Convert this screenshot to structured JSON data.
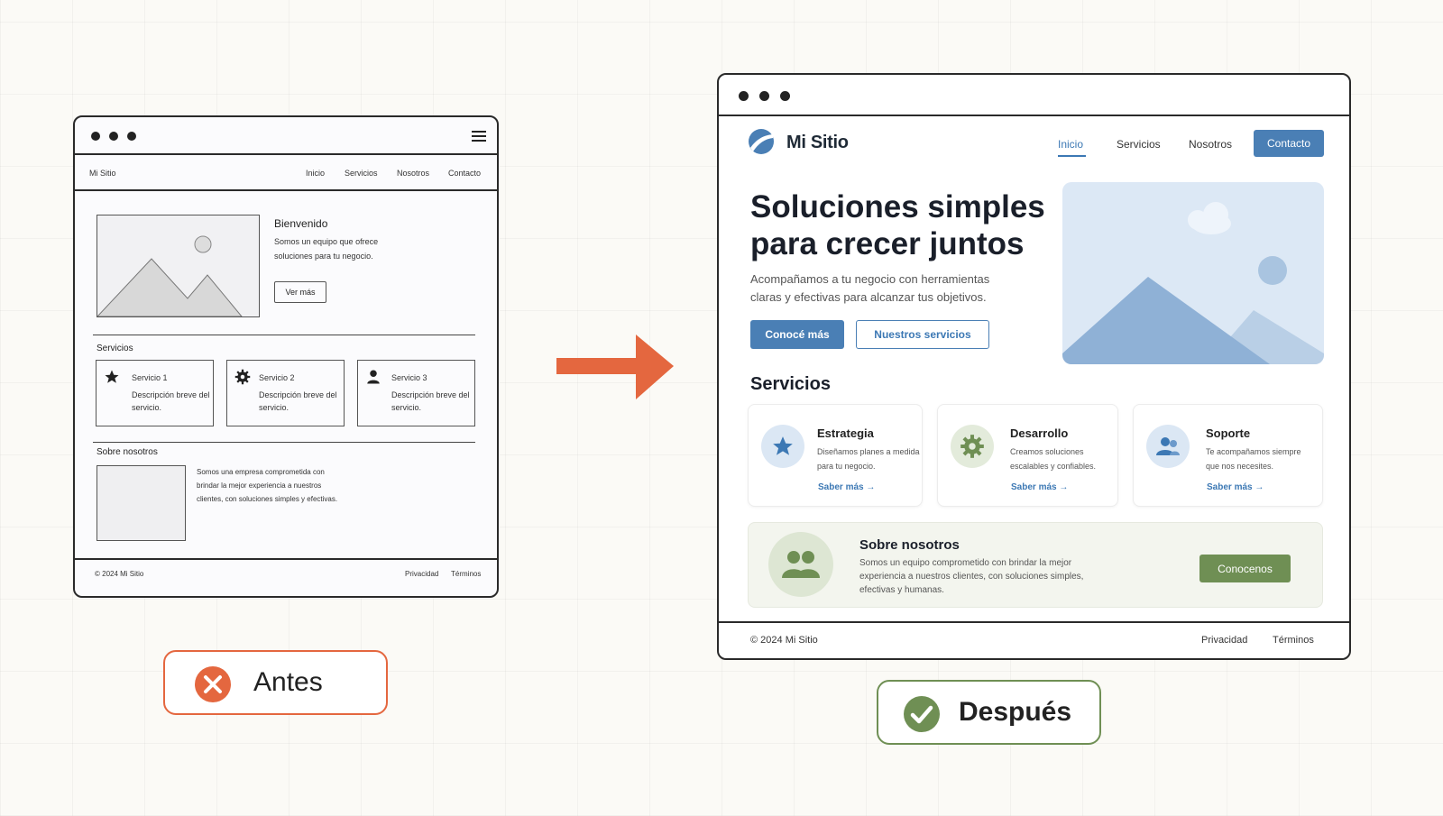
{
  "before": {
    "brand": "Mi Sitio",
    "nav": [
      "Inicio",
      "Servicios",
      "Nosotros",
      "Contacto"
    ],
    "hero_title": "Bienvenido",
    "hero_text_1": "Somos un equipo que ofrece",
    "hero_text_2": "soluciones para tu negocio.",
    "hero_button": "Ver más",
    "services_heading": "Servicios",
    "services": [
      {
        "title": "Servicio 1",
        "desc_1": "Descripción breve del",
        "desc_2": "servicio.",
        "icon": "star-icon"
      },
      {
        "title": "Servicio 2",
        "desc_1": "Descripción breve del",
        "desc_2": "servicio.",
        "icon": "gear-icon"
      },
      {
        "title": "Servicio 3",
        "desc_1": "Descripción breve del",
        "desc_2": "servicio.",
        "icon": "person-icon"
      }
    ],
    "about_heading": "Sobre nosotros",
    "about_text_1": "Somos una empresa comprometida con",
    "about_text_2": "brindar la mejor experiencia a nuestros",
    "about_text_3": "clientes, con soluciones simples y efectivas.",
    "footer_copy": "© 2024 Mi Sitio",
    "footer_links": [
      "Privacidad",
      "Términos"
    ]
  },
  "after": {
    "brand": "Mi Sitio",
    "nav": [
      "Inicio",
      "Servicios",
      "Nosotros"
    ],
    "nav_cta": "Contacto",
    "hero_title_1": "Soluciones simples",
    "hero_title_2": "para crecer juntos",
    "hero_sub_1": "Acompañamos a tu negocio con herramientas",
    "hero_sub_2": "claras y efectivas para alcanzar tus objetivos.",
    "btn_primary": "Conocé más",
    "btn_secondary": "Nuestros servicios",
    "services_heading": "Servicios",
    "services": [
      {
        "title": "Estrategia",
        "desc_1": "Diseñamos planes a medida",
        "desc_2": "para tu negocio.",
        "link": "Saber más →",
        "icon": "star-icon"
      },
      {
        "title": "Desarrollo",
        "desc_1": "Creamos soluciones",
        "desc_2": "escalables y confiables.",
        "link": "Saber más →",
        "icon": "gear-icon"
      },
      {
        "title": "Soporte",
        "desc_1": "Te acompañamos siempre",
        "desc_2": "que nos necesites.",
        "link": "Saber más →",
        "icon": "people-icon"
      }
    ],
    "about_heading": "Sobre nosotros",
    "about_text_1": "Somos un equipo comprometido con brindar la mejor",
    "about_text_2": "experiencia a nuestros clientes, con soluciones simples,",
    "about_text_3": "efectivas y humanas.",
    "about_button": "Conocenos",
    "footer_copy": "© 2024 Mi Sitio",
    "footer_links": [
      "Privacidad",
      "Términos"
    ]
  },
  "labels": {
    "before": "Antes",
    "after": "Después"
  },
  "colors": {
    "arrow": "#e4673f",
    "before_accent": "#e4673f",
    "after_accent": "#6f8f54",
    "primary_blue": "#4a7fb5",
    "green_button": "#6f8f54"
  }
}
